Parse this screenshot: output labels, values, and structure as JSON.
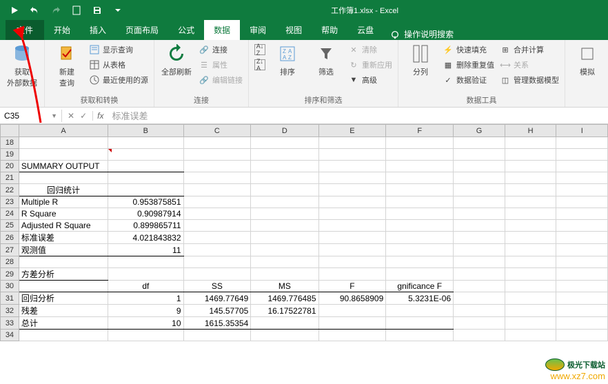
{
  "title": "工作簿1.xlsx - Excel",
  "tabs": {
    "file": "文件",
    "home": "开始",
    "insert": "插入",
    "layout": "页面布局",
    "formulas": "公式",
    "data": "数据",
    "review": "审阅",
    "view": "视图",
    "help": "帮助",
    "cloud": "云盘",
    "tellme": "操作说明搜索"
  },
  "ribbon": {
    "ext": {
      "label": "获取\n外部数据",
      "group": ""
    },
    "get": {
      "newq": "新建\n查询",
      "show": "显示查询",
      "table": "从表格",
      "recent": "最近使用的源",
      "group": "获取和转换"
    },
    "conn": {
      "refresh": "全部刷新",
      "conns": "连接",
      "props": "属性",
      "edit": "编辑链接",
      "group": "连接"
    },
    "sort": {
      "az": "A↓Z",
      "za": "Z↓A",
      "sort": "排序",
      "filter": "筛选",
      "clear": "清除",
      "reapply": "重新应用",
      "adv": "高级",
      "group": "排序和筛选"
    },
    "tools": {
      "split": "分列",
      "flash": "快速填充",
      "dup": "删除重复值",
      "valid": "数据验证",
      "consol": "合并计算",
      "rel": "关系",
      "model": "管理数据模型",
      "group": "数据工具"
    },
    "sim": {
      "label": "模拟"
    }
  },
  "nameBox": "C35",
  "formulaValue": "标准误差",
  "cols": [
    "A",
    "B",
    "C",
    "D",
    "E",
    "F",
    "G",
    "H",
    "I"
  ],
  "rows": [
    18,
    19,
    20,
    21,
    22,
    23,
    24,
    25,
    26,
    27,
    28,
    29,
    30,
    31,
    32,
    33,
    34
  ],
  "cells": {
    "A20": "SUMMARY OUTPUT",
    "A22": "回归统计",
    "A23": "Multiple R",
    "B23": "0.953875851",
    "A24": "R Square",
    "B24": "0.90987914",
    "A25": "Adjusted R Square",
    "B25": "0.899865711",
    "A26": "标准误差",
    "B26": "4.021843832",
    "A27": "观测值",
    "B27": "11",
    "A29": "方差分析",
    "B30": "df",
    "C30": "SS",
    "D30": "MS",
    "E30": "F",
    "F30": "gnificance F",
    "A31": "回归分析",
    "B31": "1",
    "C31": "1469.77649",
    "D31": "1469.776485",
    "E31": "90.8658909",
    "F31": "5.3231E-06",
    "A32": "残差",
    "B32": "9",
    "C32": "145.57705",
    "D32": "16.17522781",
    "A33": "总计",
    "B33": "10",
    "C33": "1615.35354"
  },
  "chart_data": {
    "type": "table",
    "title": "SUMMARY OUTPUT",
    "regression_stats": {
      "Multiple R": 0.953875851,
      "R Square": 0.90987914,
      "Adjusted R Square": 0.899865711,
      "标准误差": 4.021843832,
      "观测值": 11
    },
    "anova": {
      "columns": [
        "",
        "df",
        "SS",
        "MS",
        "F",
        "Significance F"
      ],
      "rows": [
        [
          "回归分析",
          1,
          1469.77649,
          1469.776485,
          90.8658909,
          5.3231e-06
        ],
        [
          "残差",
          9,
          145.57705,
          16.17522781,
          null,
          null
        ],
        [
          "总计",
          10,
          1615.35354,
          null,
          null,
          null
        ]
      ]
    }
  },
  "watermark": {
    "name": "极光下载站",
    "url": "www.xz7.com"
  }
}
